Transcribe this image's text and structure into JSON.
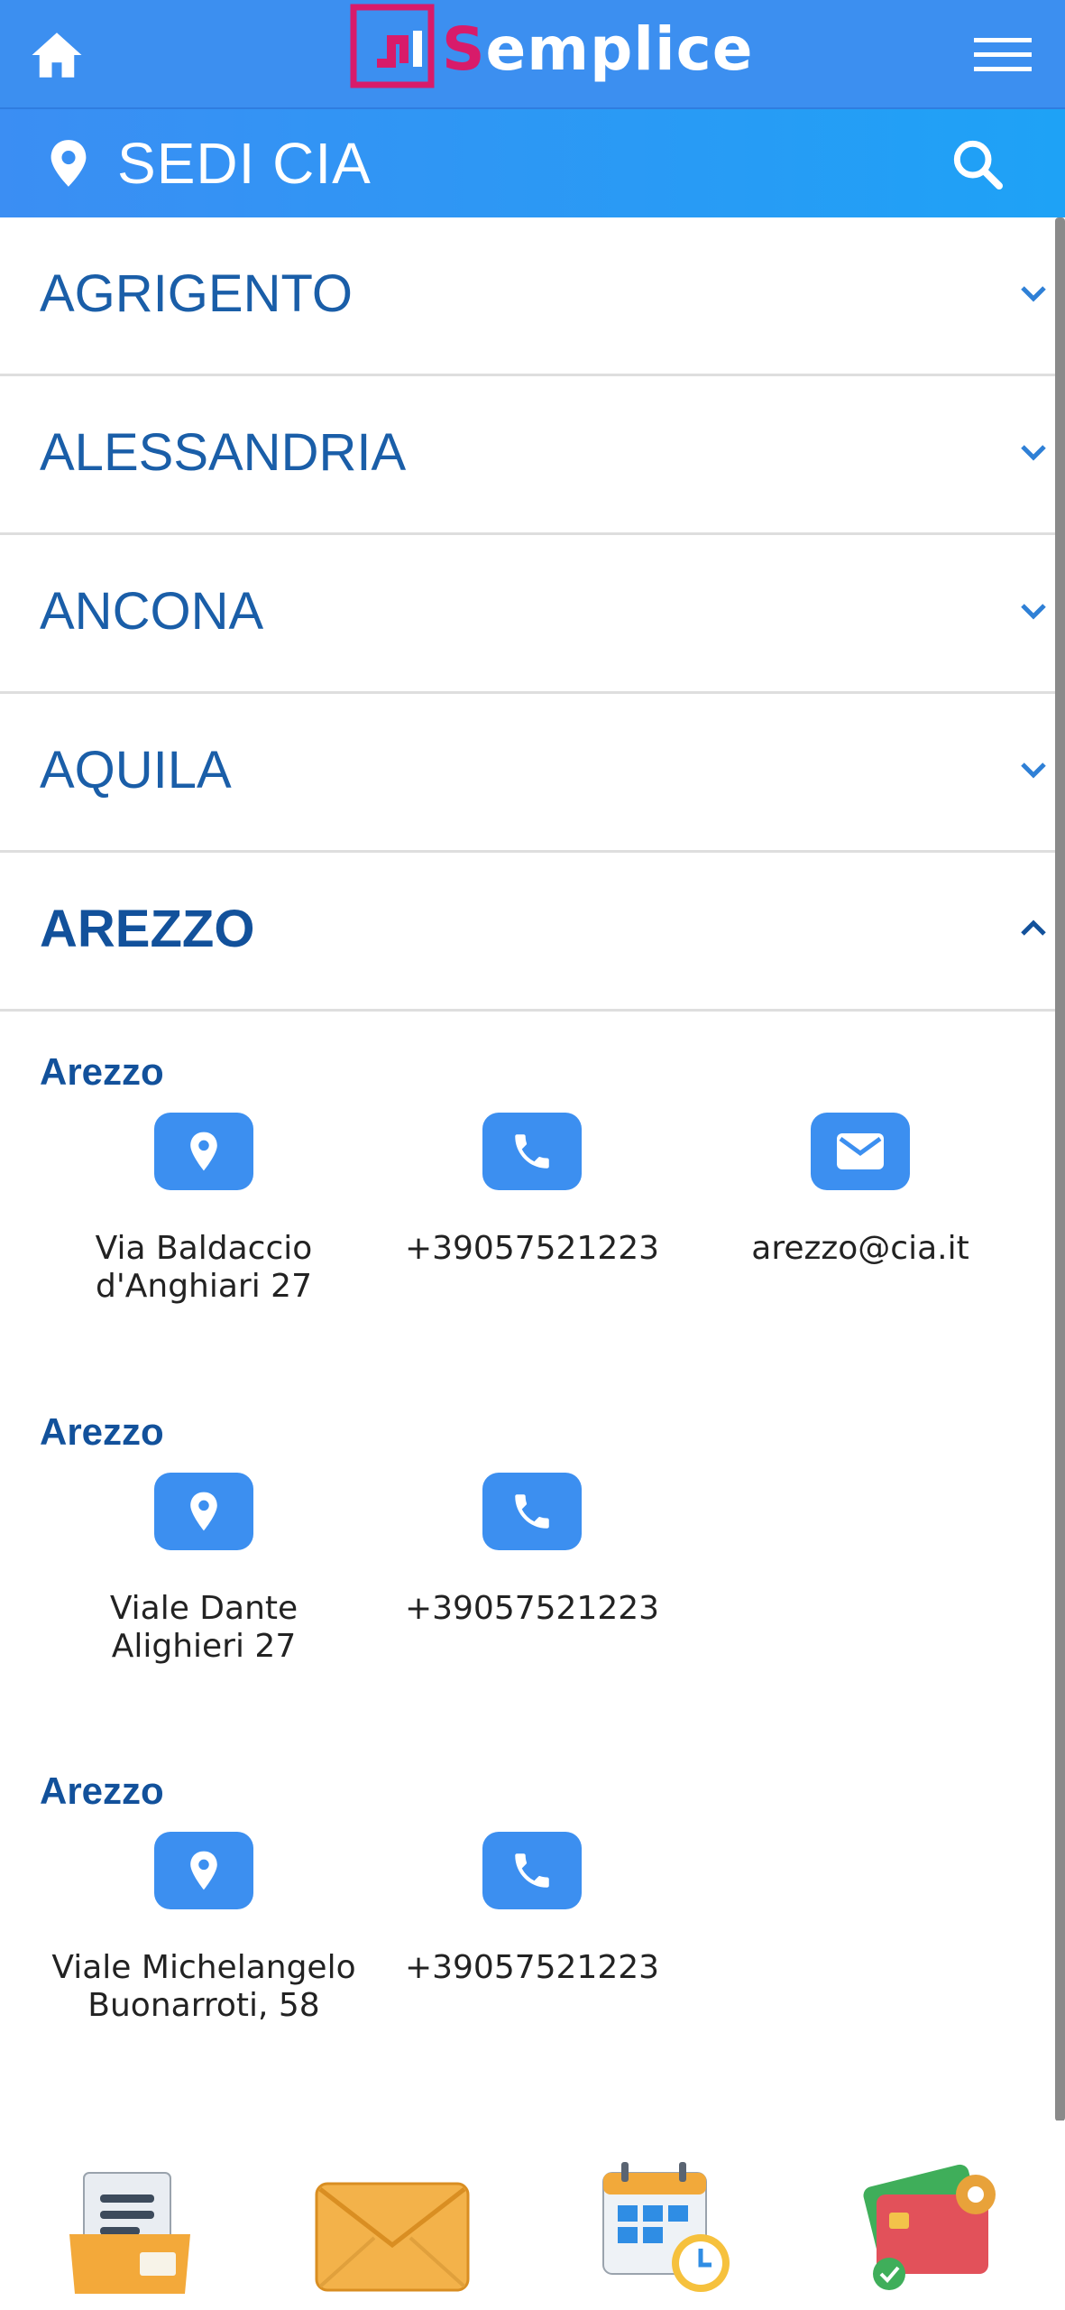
{
  "header": {
    "logo_text_first": "S",
    "logo_text_rest": "emplice",
    "brand_color": "#3c8ff0",
    "accent_color": "#d81b6a"
  },
  "section": {
    "title": "SEDI CIA"
  },
  "accordion": [
    {
      "label": "AGRIGENTO",
      "open": false
    },
    {
      "label": "ALESSANDRIA",
      "open": false
    },
    {
      "label": "ANCONA",
      "open": false
    },
    {
      "label": "AQUILA",
      "open": false
    },
    {
      "label": "AREZZO",
      "open": true
    }
  ],
  "offices": [
    {
      "city": "Arezzo",
      "address": "Via Baldaccio d'Anghiari 27",
      "phone": "+39057521223",
      "email": "arezzo@cia.it"
    },
    {
      "city": "Arezzo",
      "address": "Viale Dante Alighieri 27",
      "phone": "+39057521223"
    },
    {
      "city": "Arezzo",
      "address": "Viale Michelangelo Buonarroti, 58",
      "phone": "+39057521223"
    }
  ],
  "bottom_nav": [
    {
      "icon": "document-folder-icon"
    },
    {
      "icon": "envelope-icon"
    },
    {
      "icon": "calendar-clock-icon"
    },
    {
      "icon": "credit-card-settings-icon"
    }
  ]
}
